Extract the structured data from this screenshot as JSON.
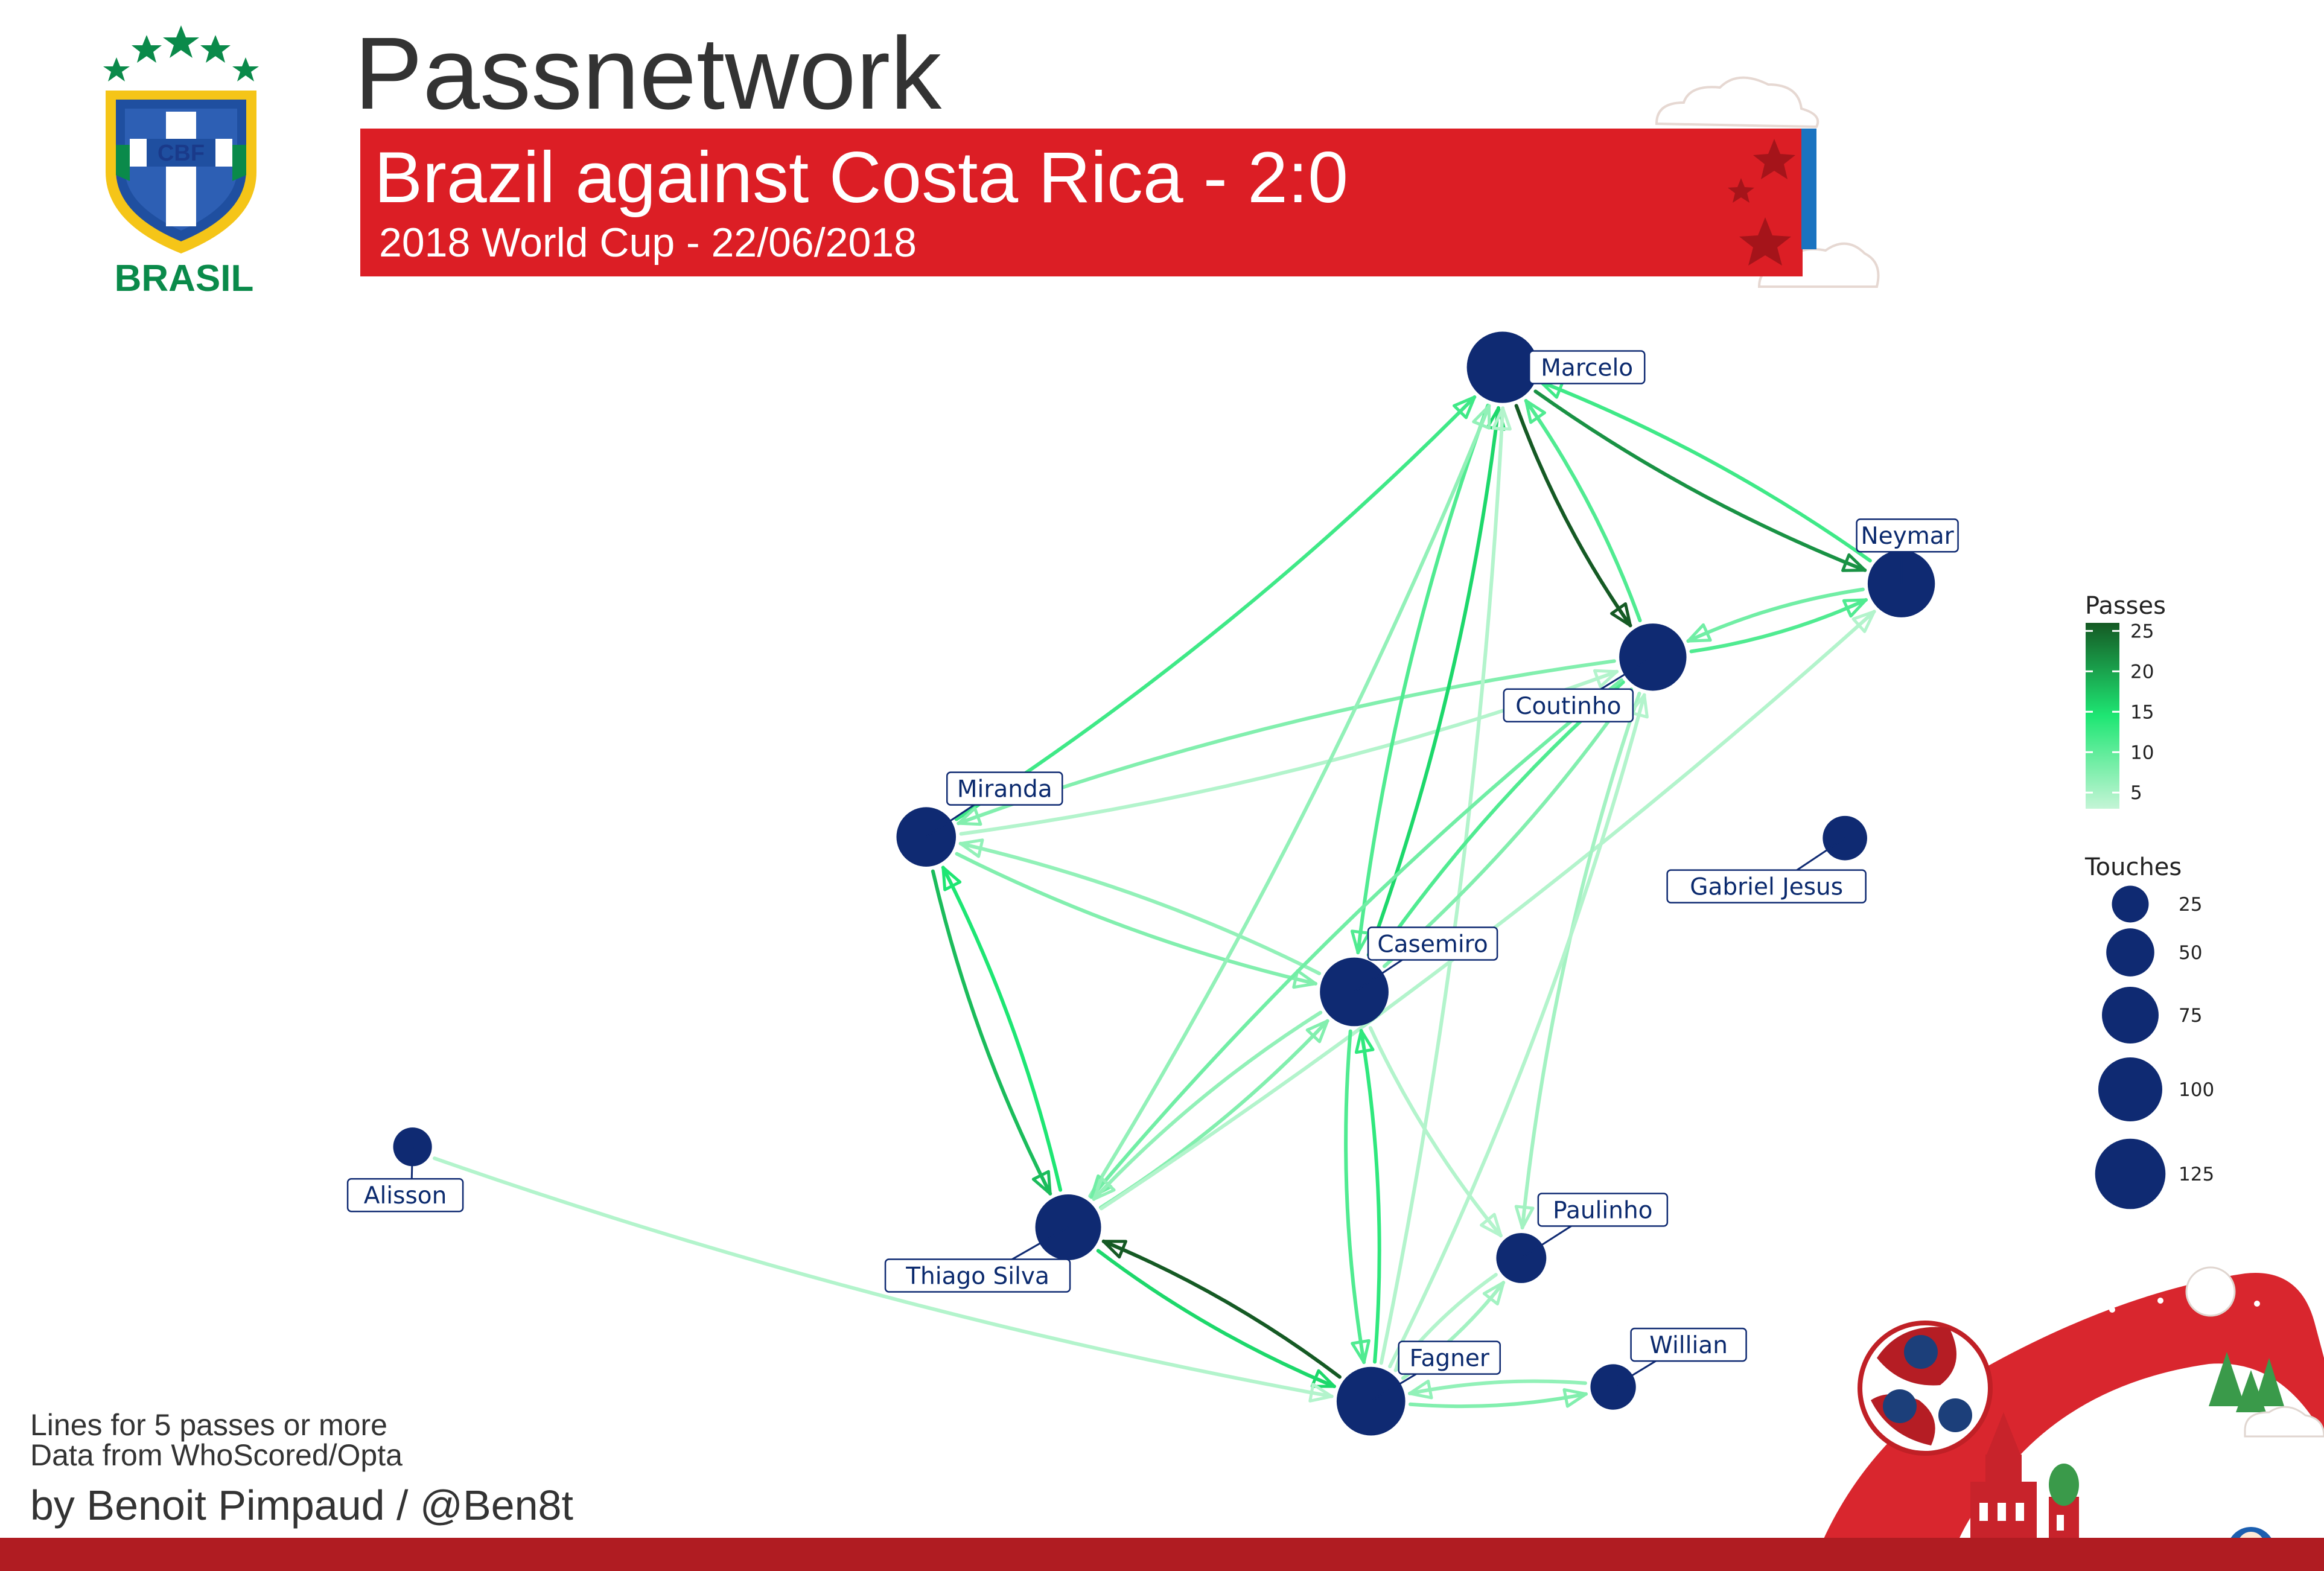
{
  "header": {
    "title": "Passnetwork",
    "banner_title": "Brazil against Costa Rica - 2:0",
    "banner_subtitle": "2018 World Cup - 22/06/2018",
    "banner_color": "#dc1e25",
    "banner_stripe_color": "#1a73c0"
  },
  "logo": {
    "icon": "cbf-crest-icon",
    "crest_text": "CBF",
    "wordmark": "BRASIL"
  },
  "footer": {
    "note_1": "Lines for 5 passes or more",
    "note_2": "Data from WhoScored/Opta",
    "byline": "by Benoit Pimpaud / @Ben8t",
    "decoration": "world-cup-2018-decoration-icon",
    "bottom_bar_color": "#b01c22"
  },
  "colors": {
    "node": "#0f2a72",
    "label_text": "#0b2a6e",
    "edge_low": "#c4f5d6",
    "edge_mid": "#1ee673",
    "edge_high": "#155a24"
  },
  "chart_data": {
    "type": "network",
    "nodes": [
      {
        "id": "marcelo",
        "label": "Marcelo",
        "x": 68.2,
        "y": 91.4,
        "touches": 105
      },
      {
        "id": "neymar",
        "label": "Neymar",
        "x": 87.3,
        "y": 73.1,
        "touches": 90
      },
      {
        "id": "coutinho",
        "label": "Coutinho",
        "x": 75.4,
        "y": 66.9,
        "touches": 90
      },
      {
        "id": "miranda",
        "label": "Miranda",
        "x": 40.6,
        "y": 51.7,
        "touches": 65
      },
      {
        "id": "casemiro",
        "label": "Casemiro",
        "x": 61.1,
        "y": 38.6,
        "touches": 95
      },
      {
        "id": "gabriel_jesus",
        "label": "Gabriel Jesus",
        "x": 84.6,
        "y": 51.6,
        "touches": 28
      },
      {
        "id": "alisson",
        "label": "Alisson",
        "x": 16.0,
        "y": 25.5,
        "touches": 18
      },
      {
        "id": "thiago_silva",
        "label": "Thiago Silva",
        "x": 47.4,
        "y": 18.7,
        "touches": 85
      },
      {
        "id": "paulinho",
        "label": "Paulinho",
        "x": 69.1,
        "y": 16.1,
        "touches": 40
      },
      {
        "id": "fagner",
        "label": "Fagner",
        "x": 61.9,
        "y": 4.0,
        "touches": 95
      },
      {
        "id": "willian",
        "label": "Willian",
        "x": 73.5,
        "y": 5.2,
        "touches": 30
      }
    ],
    "edges": [
      {
        "from": "marcelo",
        "to": "neymar",
        "passes": 21
      },
      {
        "from": "neymar",
        "to": "marcelo",
        "passes": 13
      },
      {
        "from": "marcelo",
        "to": "coutinho",
        "passes": 25
      },
      {
        "from": "coutinho",
        "to": "marcelo",
        "passes": 12
      },
      {
        "from": "coutinho",
        "to": "neymar",
        "passes": 12
      },
      {
        "from": "neymar",
        "to": "coutinho",
        "passes": 10
      },
      {
        "from": "miranda",
        "to": "marcelo",
        "passes": 13
      },
      {
        "from": "miranda",
        "to": "coutinho",
        "passes": 6
      },
      {
        "from": "coutinho",
        "to": "miranda",
        "passes": 9
      },
      {
        "from": "miranda",
        "to": "casemiro",
        "passes": 9
      },
      {
        "from": "casemiro",
        "to": "miranda",
        "passes": 8
      },
      {
        "from": "miranda",
        "to": "thiago_silva",
        "passes": 18
      },
      {
        "from": "thiago_silva",
        "to": "miranda",
        "passes": 15
      },
      {
        "from": "casemiro",
        "to": "marcelo",
        "passes": 16
      },
      {
        "from": "marcelo",
        "to": "casemiro",
        "passes": 12
      },
      {
        "from": "thiago_silva",
        "to": "marcelo",
        "passes": 8
      },
      {
        "from": "fagner",
        "to": "marcelo",
        "passes": 6
      },
      {
        "from": "coutinho",
        "to": "casemiro",
        "passes": 12
      },
      {
        "from": "casemiro",
        "to": "coutinho",
        "passes": 9
      },
      {
        "from": "coutinho",
        "to": "thiago_silva",
        "passes": 10
      },
      {
        "from": "thiago_silva",
        "to": "casemiro",
        "passes": 9
      },
      {
        "from": "casemiro",
        "to": "thiago_silva",
        "passes": 8
      },
      {
        "from": "thiago_silva",
        "to": "neymar",
        "passes": 6
      },
      {
        "from": "coutinho",
        "to": "paulinho",
        "passes": 7
      },
      {
        "from": "fagner",
        "to": "coutinho",
        "passes": 6
      },
      {
        "from": "casemiro",
        "to": "paulinho",
        "passes": 6
      },
      {
        "from": "fagner",
        "to": "casemiro",
        "passes": 14
      },
      {
        "from": "casemiro",
        "to": "fagner",
        "passes": 12
      },
      {
        "from": "fagner",
        "to": "thiago_silva",
        "passes": 25
      },
      {
        "from": "thiago_silva",
        "to": "fagner",
        "passes": 16
      },
      {
        "from": "fagner",
        "to": "paulinho",
        "passes": 7
      },
      {
        "from": "paulinho",
        "to": "fagner",
        "passes": 6
      },
      {
        "from": "alisson",
        "to": "fagner",
        "passes": 6
      },
      {
        "from": "fagner",
        "to": "willian",
        "passes": 9
      },
      {
        "from": "willian",
        "to": "fagner",
        "passes": 8
      }
    ],
    "legend_passes": {
      "title": "Passes",
      "ticks": [
        25,
        20,
        15,
        10,
        5
      ]
    },
    "legend_touches": {
      "title": "Touches",
      "values": [
        25,
        50,
        75,
        100,
        125
      ]
    },
    "xlim": [
      0,
      100
    ],
    "ylim": [
      0,
      100
    ],
    "grid": false
  }
}
